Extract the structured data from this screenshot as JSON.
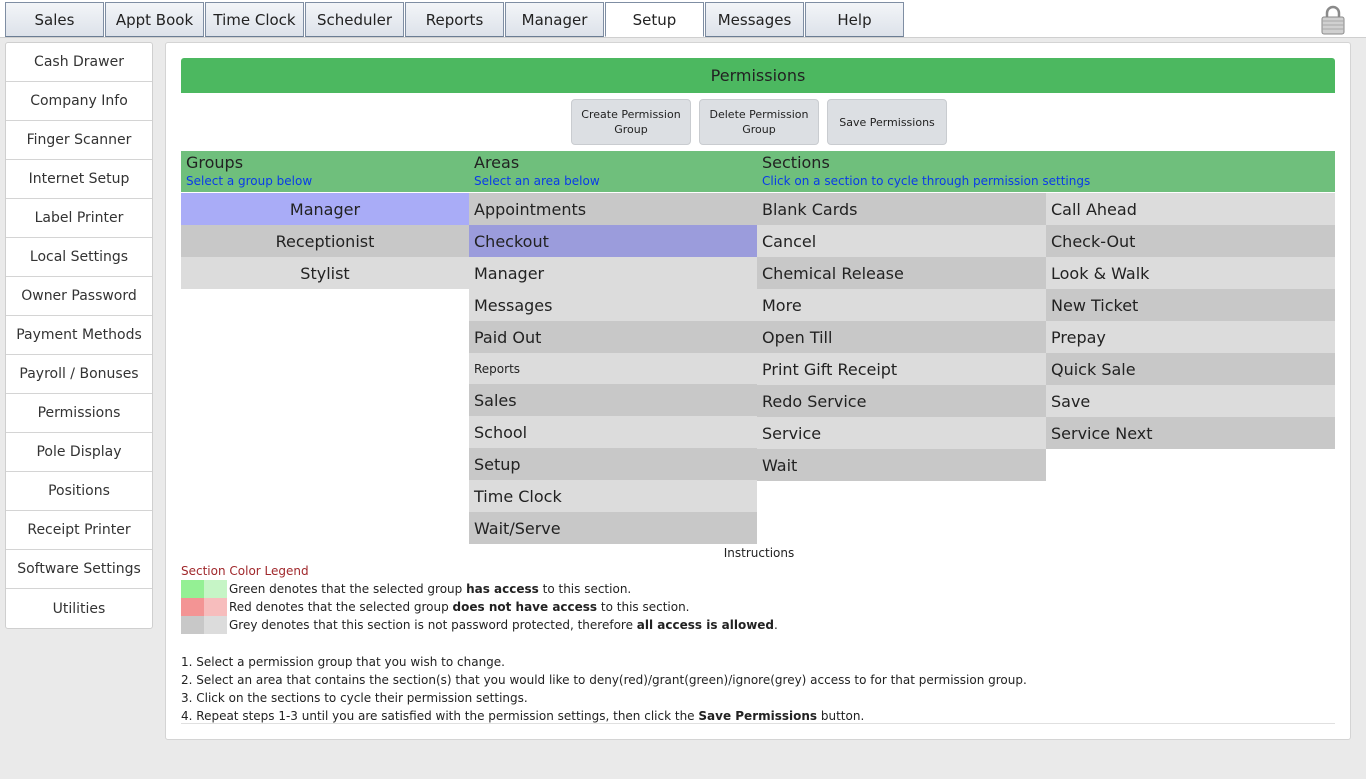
{
  "nav": {
    "tabs": [
      "Sales",
      "Appt Book",
      "Time Clock",
      "Scheduler",
      "Reports",
      "Manager",
      "Setup",
      "Messages",
      "Help"
    ],
    "active": "Setup"
  },
  "sidebar": {
    "items": [
      "Cash Drawer",
      "Company Info",
      "Finger Scanner",
      "Internet Setup",
      "Label Printer",
      "Local Settings",
      "Owner Password",
      "Payment Methods",
      "Payroll / Bonuses",
      "Permissions",
      "Pole Display",
      "Positions",
      "Receipt Printer",
      "Software Settings",
      "Utilities"
    ]
  },
  "main": {
    "title": "Permissions",
    "buttons": {
      "create": "Create Permission Group",
      "delete": "Delete Permission Group",
      "save": "Save Permissions"
    },
    "headers": {
      "groups": {
        "title": "Groups",
        "sub": "Select a group below"
      },
      "areas": {
        "title": "Areas",
        "sub": "Select an area below"
      },
      "sections": {
        "title": "Sections",
        "sub": "Click on a section to cycle through permission settings"
      }
    },
    "groups": [
      "Manager",
      "Receptionist",
      "Stylist"
    ],
    "selected_group": "Manager",
    "areas": [
      "Appointments",
      "Checkout",
      "Manager",
      "Messages",
      "Paid Out",
      "Reports",
      "Sales",
      "School",
      "Setup",
      "Time Clock",
      "Wait/Serve"
    ],
    "selected_area": "Checkout",
    "sections_left": [
      "Blank Cards",
      "Cancel",
      "Chemical Release",
      "More",
      "Open Till",
      "Print Gift Receipt",
      "Redo Service",
      "Service",
      "Wait"
    ],
    "sections_right": [
      "Call Ahead",
      "Check-Out",
      "Look & Walk",
      "New Ticket",
      "Prepay",
      "Quick Sale",
      "Save",
      "Service Next"
    ],
    "instructions_title": "Instructions",
    "legend": {
      "title": "Section Color Legend",
      "green": {
        "pre": "Green denotes that the selected group ",
        "bold": "has access",
        "post": " to this section."
      },
      "red": {
        "pre": "Red denotes that the selected group ",
        "bold": "does not have access",
        "post": " to this section."
      },
      "grey": {
        "pre": "Grey denotes that this section is not password protected, therefore ",
        "bold": "all access is allowed",
        "post": "."
      },
      "colors": {
        "green1": "#94f094",
        "green2": "#c6f5c6",
        "red1": "#f39494",
        "red2": "#f7bdbd",
        "grey1": "#c8c8c8",
        "grey2": "#dcdcdc"
      }
    },
    "steps": {
      "s1": "1. Select a permission group that you wish to change.",
      "s2": "2. Select an area that contains the section(s) that you would like to deny(red)/grant(green)/ignore(grey) access to for that permission group.",
      "s3": "3. Click on the sections to cycle their permission settings.",
      "s4_pre": "4. Repeat steps 1-3 until you are satisfied with the permission settings, then click the ",
      "s4_bold": "Save Permissions",
      "s4_post": " button."
    }
  }
}
